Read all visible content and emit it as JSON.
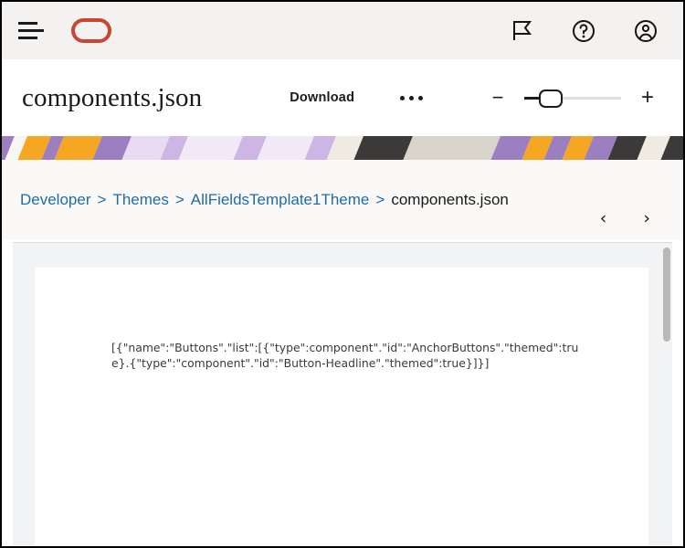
{
  "topbar": {
    "menu_icon": "hamburger-menu-icon",
    "logo": "oracle-logo",
    "flag_icon": "flag-icon",
    "help_icon": "help-circle-icon",
    "account_icon": "user-account-icon"
  },
  "fileheader": {
    "title": "components.json",
    "download_label": "Download",
    "more_label": "more-options-icon",
    "zoom": {
      "minus": "−",
      "plus": "+",
      "value": 20
    }
  },
  "breadcrumb": {
    "items": [
      {
        "label": "Developer",
        "current": false
      },
      {
        "label": "Themes",
        "current": false
      },
      {
        "label": "AllFieldsTemplate1Theme",
        "current": false
      },
      {
        "label": "components.json",
        "current": true
      }
    ],
    "separator": ">",
    "prev_label": "‹",
    "next_label": "›"
  },
  "document": {
    "content": "[{\"name\":\"Buttons\".\"list\":[{\"type\":component\".\"id\":\"AnchorButtons\".\"themed\":true}.{\"type\":\"component\".\"id\":\"Button-Headline\".\"themed\":true}]}]"
  },
  "colors": {
    "brand_red": "#c74634",
    "link_blue": "#1f6ca8",
    "topbar_bg": "#f4f2f0",
    "crumbbar_bg": "#faf9f7",
    "viewer_bg": "#f1f3f5",
    "banner_purple": "#9b7fc0",
    "banner_lilac": "#e7dcf2",
    "banner_orange": "#f5a623",
    "banner_dark": "#3b3a38",
    "banner_light": "#efeae2"
  }
}
